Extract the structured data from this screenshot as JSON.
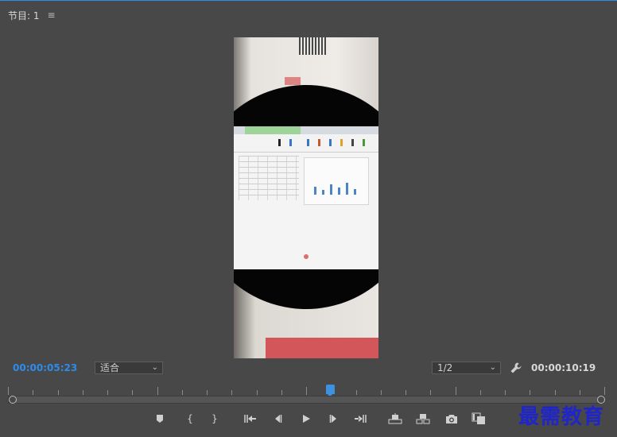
{
  "panel": {
    "title": "节目: 1",
    "menu_icon": "hamburger-icon"
  },
  "program_monitor": {
    "current_time": "00:00:05:23",
    "duration": "00:00:10:19",
    "zoom_select": {
      "value": "适合"
    },
    "resolution_select": {
      "value": "1/2"
    },
    "playhead_fraction": 0.54
  },
  "transport": {
    "buttons": [
      {
        "name": "add-marker-button",
        "icon": "marker-icon"
      },
      {
        "name": "mark-in-button",
        "icon": "mark-in-icon"
      },
      {
        "name": "mark-out-button",
        "icon": "mark-out-icon"
      },
      {
        "name": "go-to-in-button",
        "icon": "go-to-in-icon"
      },
      {
        "name": "step-back-button",
        "icon": "step-back-icon"
      },
      {
        "name": "play-button",
        "icon": "play-icon"
      },
      {
        "name": "step-forward-button",
        "icon": "step-forward-icon"
      },
      {
        "name": "go-to-out-button",
        "icon": "go-to-out-icon"
      },
      {
        "name": "lift-button",
        "icon": "lift-icon"
      },
      {
        "name": "extract-button",
        "icon": "extract-icon"
      },
      {
        "name": "export-frame-button",
        "icon": "camera-icon"
      },
      {
        "name": "comparison-view-button",
        "icon": "comparison-icon"
      }
    ]
  },
  "watermark": {
    "text": "最需教育"
  },
  "colors": {
    "accent": "#2d8ceb",
    "panel_bg": "#484848",
    "watermark": "#1f25c9"
  }
}
